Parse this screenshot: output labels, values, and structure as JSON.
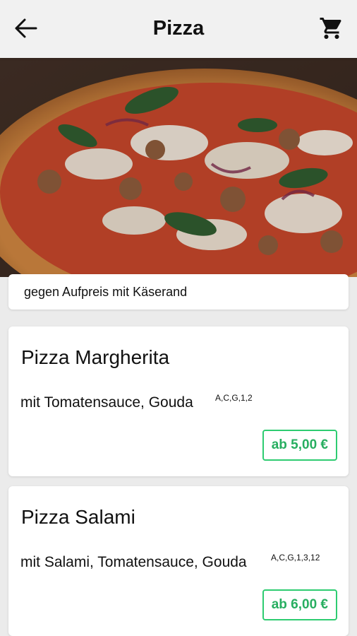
{
  "header": {
    "title": "Pizza",
    "back_icon": "arrow-left-icon",
    "cart_icon": "shopping-cart-icon"
  },
  "hero": {
    "image": "pizza-photo"
  },
  "note": "gegen Aufpreis mit Käserand",
  "products": [
    {
      "name": "Pizza Margherita",
      "description": "mit Tomatensauce, Gouda",
      "allergens": "A,C,G,1,2",
      "price": "ab 5,00 €"
    },
    {
      "name": "Pizza Salami",
      "description": "mit Salami, Tomatensauce, Gouda",
      "allergens": "A,C,G,1,3,12",
      "price": "ab 6,00 €"
    }
  ],
  "colors": {
    "accent": "#2ecc71",
    "price_text": "#27ae60",
    "appbar": "#f1f1f1",
    "background": "#ebebeb"
  }
}
